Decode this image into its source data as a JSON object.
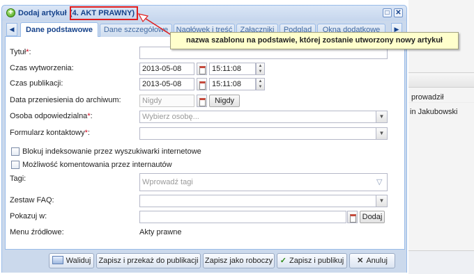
{
  "window": {
    "title": "Dodaj artykuł",
    "template_name": "(4. AKT PRAWNY)"
  },
  "tabs": [
    {
      "label": "Dane podstawowe"
    },
    {
      "label": "Dane szczegółowe"
    },
    {
      "label": "Nagłówek i treść"
    },
    {
      "label": "Załączniki"
    },
    {
      "label": "Podgląd"
    },
    {
      "label": "Okna dodatkowe"
    }
  ],
  "form": {
    "title_label": "Tytuł",
    "required_mark": "*",
    "label_colon": ":",
    "created_label": "Czas wytworzenia:",
    "created_date": "2013-05-08",
    "created_time": "15:11:08",
    "published_label": "Czas publikacji:",
    "published_date": "2013-05-08",
    "published_time": "15:11:08",
    "archive_label": "Data przeniesienia do archiwum:",
    "archive_placeholder": "Nigdy",
    "archive_button": "Nigdy",
    "person_label": "Osoba odpowiedzialna",
    "person_placeholder": "Wybierz osobę...",
    "contact_form_label": "Formularz kontaktowy",
    "block_indexing_label": "Blokuj indeksowanie przez wyszukiwarki internetowe",
    "allow_comments_label": "Możliwość komentowania przez internautów",
    "tags_label": "Tagi:",
    "tags_placeholder": "Wprowadź tagi",
    "faq_label": "Zestaw FAQ:",
    "show_in_label": "Pokazuj w:",
    "show_in_button": "Dodaj",
    "source_menu_label": "Menu źródłowe:",
    "source_menu_value": "Akty prawne"
  },
  "footer": {
    "validate": "Waliduj",
    "save_and_pass": "Zapisz i przekaż do publikacji",
    "save_draft": "Zapisz jako roboczy",
    "save_and_publish": "Zapisz i publikuj",
    "cancel": "Anuluj"
  },
  "annotation": {
    "text": "nazwa szablonu na podstawie, której zostanie utworzony nowy artykuł"
  },
  "background": {
    "column_header": "prowadził",
    "cell": "in Jakubowski"
  },
  "colors": {
    "annotation_border": "#e11d1d",
    "required": "#d0021b",
    "title_text": "#15428b"
  }
}
